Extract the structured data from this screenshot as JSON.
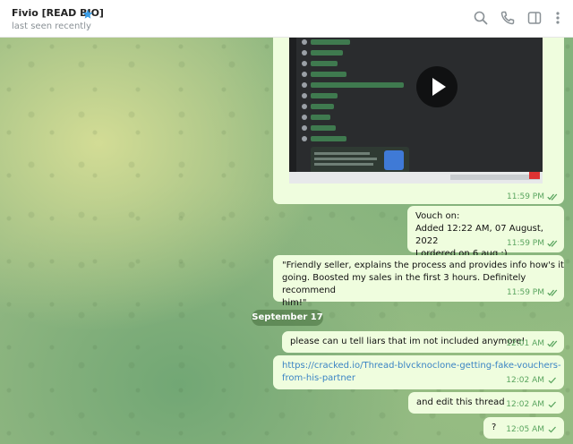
{
  "header": {
    "title": "Fivio [READ BIO]",
    "status": "last seen recently"
  },
  "icons": {
    "verified": "star-badge-icon",
    "search": "search-icon",
    "call": "phone-icon",
    "sidebar": "sidebar-toggle-icon",
    "more": "more-vertical-icon"
  },
  "colors": {
    "bubble_out": "#effdde",
    "time_green": "#5aa55f",
    "link": "#3b84c4",
    "verified_blue": "#3a9ee8"
  },
  "messages": [
    {
      "type": "video",
      "time": "11:59 PM"
    },
    {
      "lines": [
        "Vouch on:",
        "Added 12:22 AM, 07 August, 2022",
        "I ordered on 6 aug :)"
      ],
      "time": "11:59 PM"
    },
    {
      "lines": [
        "\"Friendly seller, explains the process and provides info how's it",
        "going. Boosted my sales in the first 3 hours. Definitely recommend",
        "him!\""
      ],
      "time": "11:59 PM"
    }
  ],
  "date_separator": "September 17",
  "messages2": [
    {
      "text": "please can u tell liars that im not included anymore!",
      "time": "12:01 AM"
    },
    {
      "lines": [
        "https://cracked.io/Thread-blvcknoclone-getting-fake-vouchers-",
        "from-his-partner"
      ],
      "time": "12:02 AM"
    },
    {
      "text": "and edit this thread",
      "time": "12:02 AM"
    },
    {
      "text": "?",
      "time": "12:05 AM"
    }
  ]
}
